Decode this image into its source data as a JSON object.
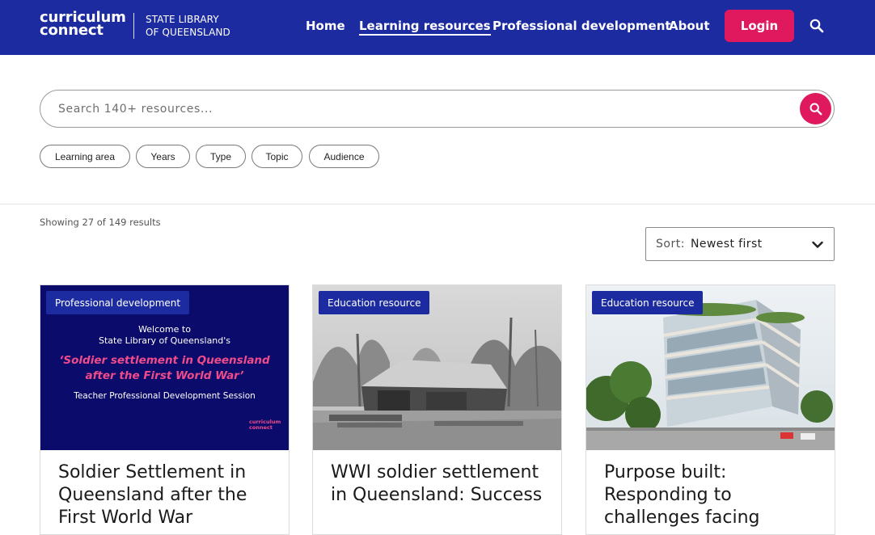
{
  "header": {
    "logo_line1": "curriculum",
    "logo_line2": "connect",
    "partner_line1": "STATE LIBRARY",
    "partner_line2": "OF QUEENSLAND",
    "nav": [
      {
        "label": "Home"
      },
      {
        "label": "Learning resources"
      },
      {
        "label": "Professional development"
      },
      {
        "label": "About"
      }
    ],
    "login_label": "Login",
    "search_icon": "search-icon"
  },
  "search": {
    "placeholder": "Search 140+ resources...",
    "value": "",
    "button_icon": "search-icon"
  },
  "filters": [
    {
      "label": "Learning area"
    },
    {
      "label": "Years"
    },
    {
      "label": "Type"
    },
    {
      "label": "Topic"
    },
    {
      "label": "Audience"
    }
  ],
  "results": {
    "summary": "Showing 27 of 149 results"
  },
  "sort": {
    "label": "Sort:",
    "value": "Newest first",
    "icon": "chevron-down-icon"
  },
  "cards": [
    {
      "badge": "Professional development",
      "title": "Soldier Settlement in Queensland after the First World War",
      "image": {
        "line1": "Welcome to",
        "line2": "State Library of Queensland's",
        "headline1": "‘Soldier settlement in Queensland",
        "headline2": "after the First World War’",
        "line3": "Teacher Professional Development Session",
        "logo1": "curriculum",
        "logo2": "connect"
      }
    },
    {
      "badge": "Education resource",
      "title": "WWI soldier settlement in Queensland: Success",
      "image": {
        "kind": "historic-photo"
      }
    },
    {
      "badge": "Education resource",
      "title": "Purpose built: Responding to challenges facing",
      "image": {
        "kind": "building-render"
      }
    }
  ],
  "colors": {
    "brand_blue": "#1c2ca0",
    "accent_pink": "#e0195f"
  }
}
